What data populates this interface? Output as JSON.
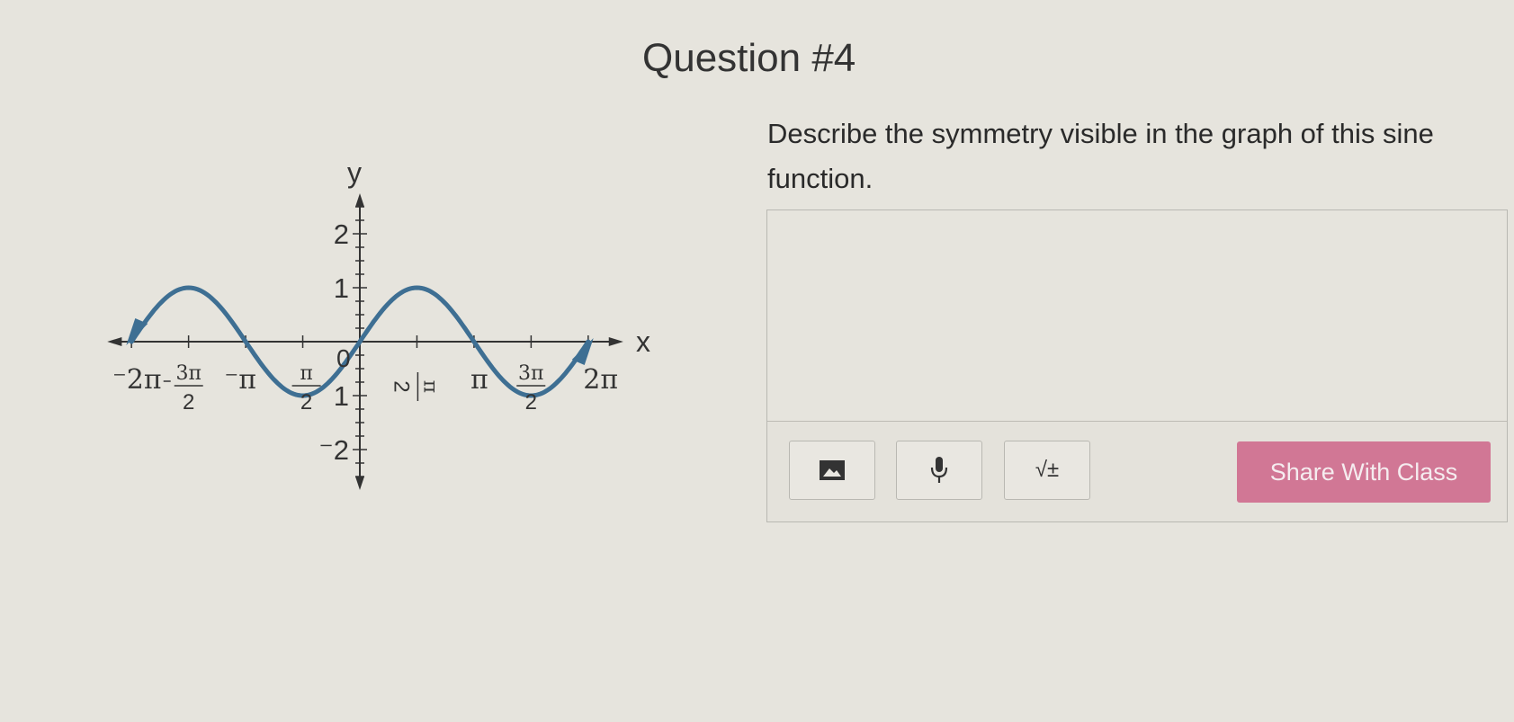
{
  "question": {
    "title": "Question #4",
    "prompt": "Describe the symmetry visible in the graph of this sine function."
  },
  "toolbar": {
    "image_icon": "image-icon",
    "mic_icon": "microphone-icon",
    "math_label": "√±",
    "share_label": "Share With Class"
  },
  "colors": {
    "curve": "#3e6f93",
    "share_button": "#d17795",
    "background": "#e6e4dd"
  },
  "chart_data": {
    "type": "line",
    "title": "",
    "xlabel": "x",
    "ylabel": "y",
    "xlim": [
      -6.6,
      7.0
    ],
    "ylim": [
      -2.6,
      2.6
    ],
    "x_tick_labels": [
      "−2π",
      "3π/2 (negative)",
      "−π",
      "π/2 (negative)",
      "0",
      "π/2",
      "π",
      "3π/2",
      "2π"
    ],
    "x_tick_values": [
      -6.2832,
      -4.7124,
      -3.1416,
      -1.5708,
      0,
      1.5708,
      3.1416,
      4.7124,
      6.2832
    ],
    "y_tick_labels": [
      "2",
      "1",
      "0",
      "−1",
      "−2"
    ],
    "y_tick_values": [
      2,
      1,
      0,
      -1,
      -2
    ],
    "series": [
      {
        "function": "sin(x)",
        "x_range": [
          -6.2832,
          6.2832
        ],
        "points": [
          [
            -6.2832,
            0
          ],
          [
            -4.7124,
            1
          ],
          [
            -3.1416,
            0
          ],
          [
            -1.5708,
            -1
          ],
          [
            0,
            0
          ],
          [
            1.5708,
            1
          ],
          [
            3.1416,
            0
          ],
          [
            4.7124,
            -1
          ],
          [
            6.2832,
            0
          ]
        ]
      }
    ],
    "grid": false,
    "legend": "none"
  }
}
